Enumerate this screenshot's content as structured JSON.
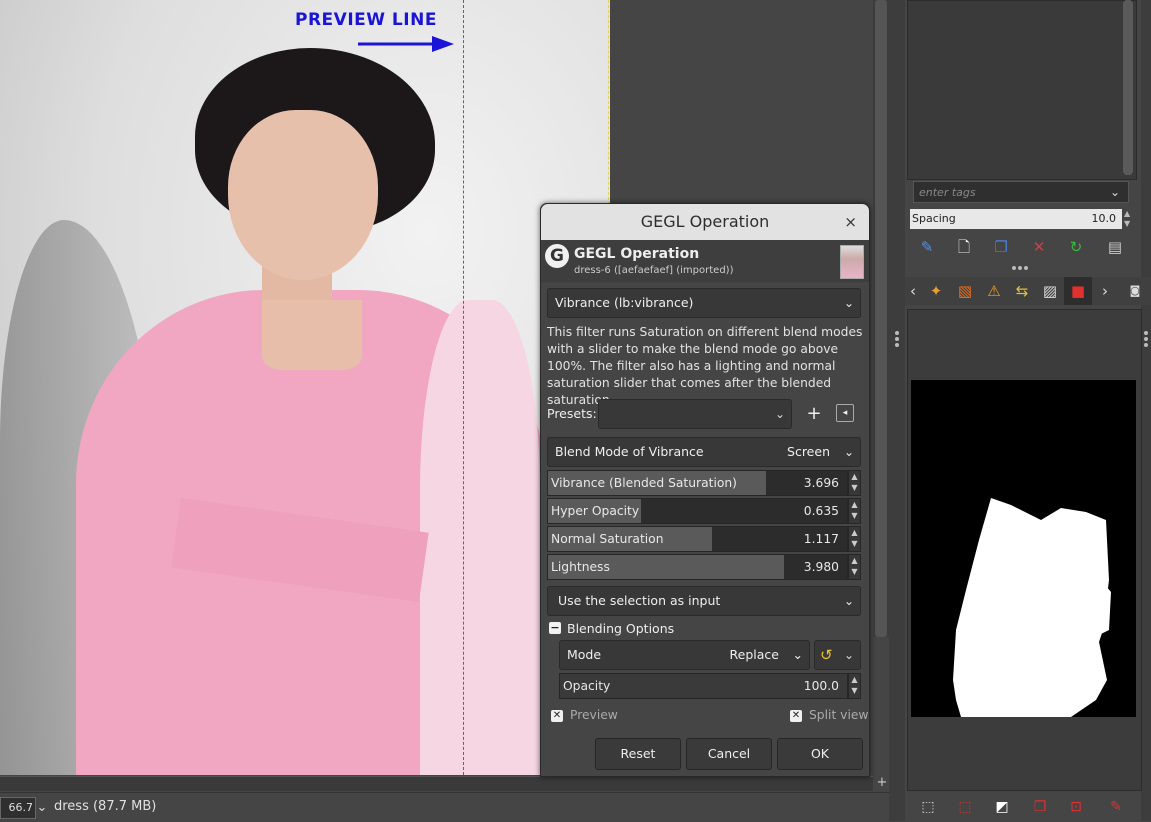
{
  "canvas": {
    "annotation_label": "PREVIEW LINE"
  },
  "status_bar": {
    "zoom": "66.7 %",
    "image_info": "dress (87.7 MB)"
  },
  "brushes_panel": {
    "tags_placeholder": "enter tags",
    "spacing_label": "Spacing",
    "spacing_value": "10.0"
  },
  "dialog": {
    "window_title": "GEGL Operation",
    "close_icon": "×",
    "header_title": "GEGL Operation",
    "header_subtitle": "dress-6 ([aefaefaef] (imported))",
    "operation": "Vibrance (lb:vibrance)",
    "description": "This filter runs Saturation on different blend modes with a slider to make the blend mode go above 100%. The filter also has a lighting and normal saturation slider that comes after the blended saturation.",
    "presets_label": "Presets:",
    "presets_value": "",
    "blend_mode": {
      "label": "Blend Mode of Vibrance",
      "value": "Screen"
    },
    "sliders": [
      {
        "label": "Vibrance (Blended Saturation)",
        "value": "3.696",
        "fill": 0.73
      },
      {
        "label": "Hyper Opacity",
        "value": "0.635",
        "fill": 0.31
      },
      {
        "label": "Normal Saturation",
        "value": "1.117",
        "fill": 0.55
      },
      {
        "label": "Lightness",
        "value": "3.980",
        "fill": 0.79
      }
    ],
    "selection_input": "Use the selection as input",
    "blending_options": {
      "label": "Blending Options",
      "mode_label": "Mode",
      "mode_value": "Replace",
      "opacity_label": "Opacity",
      "opacity_value": "100.0"
    },
    "preview_label": "Preview",
    "split_view_label": "Split view",
    "buttons": {
      "reset": "Reset",
      "cancel": "Cancel",
      "ok": "OK"
    }
  },
  "colors": {
    "accent_annotation": "#1a14d6",
    "preview_line": "#b02ad0"
  }
}
